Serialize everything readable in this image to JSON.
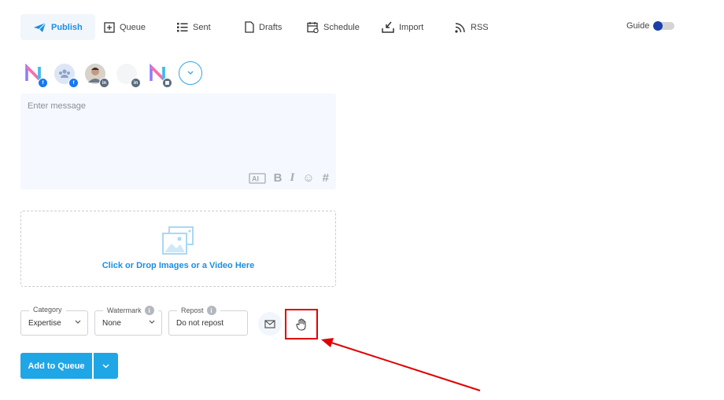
{
  "nav": {
    "items": [
      {
        "label": "Publish",
        "icon": "paper-plane-icon"
      },
      {
        "label": "Queue",
        "icon": "queue-icon"
      },
      {
        "label": "Sent",
        "icon": "list-icon"
      },
      {
        "label": "Drafts",
        "icon": "document-icon"
      },
      {
        "label": "Schedule",
        "icon": "calendar-icon"
      },
      {
        "label": "Import",
        "icon": "import-icon"
      },
      {
        "label": "RSS",
        "icon": "rss-icon"
      }
    ],
    "guide_label": "Guide",
    "guide_toggle_on": true
  },
  "accounts": [
    {
      "name": "n-logo-facebook",
      "badge": "f"
    },
    {
      "name": "group-facebook",
      "badge": "f"
    },
    {
      "name": "person-linkedin",
      "badge": "in"
    },
    {
      "name": "blank-linkedin",
      "badge": "in"
    },
    {
      "name": "n-logo-gmb",
      "badge": "▦"
    }
  ],
  "message": {
    "placeholder": "Enter message",
    "tools": [
      "AI",
      "B",
      "I",
      "☺",
      "#"
    ]
  },
  "dropzone": {
    "label": "Click or Drop Images or a Video Here"
  },
  "fields": {
    "category": {
      "legend": "Category",
      "value": "Expertise"
    },
    "watermark": {
      "legend": "Watermark",
      "value": "None"
    },
    "repost": {
      "legend": "Repost",
      "value": "Do not repost"
    }
  },
  "actions": {
    "add_to_queue_label": "Add to Queue"
  },
  "colors": {
    "accent": "#1fa6e6",
    "highlight": "#e00000",
    "message_bg": "#f5f8fe"
  }
}
